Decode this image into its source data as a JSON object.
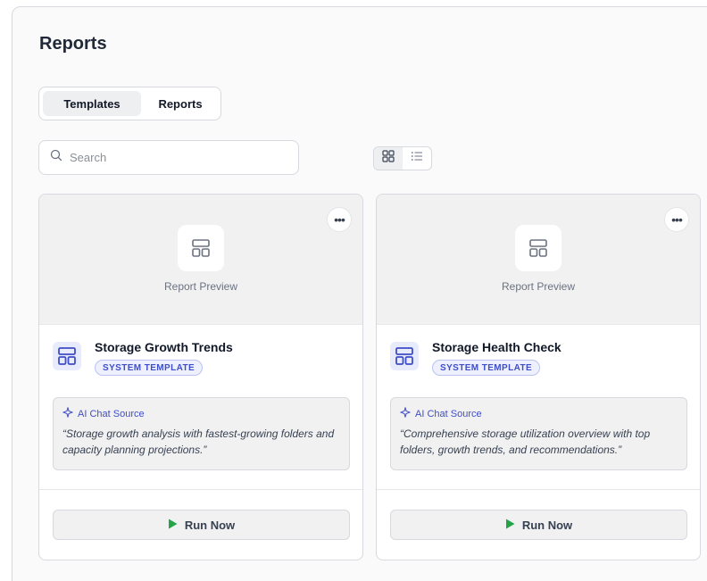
{
  "page": {
    "title": "Reports"
  },
  "tabs": [
    {
      "label": "Templates",
      "active": true
    },
    {
      "label": "Reports",
      "active": false
    }
  ],
  "search": {
    "placeholder": "Search",
    "value": ""
  },
  "view_toggle": {
    "selected": "grid",
    "options": [
      "grid-view-icon",
      "list-view-icon"
    ]
  },
  "colors": {
    "accent": "#3f4ec6",
    "run_icon": "#22a447",
    "badge_bg": "#eef1fd"
  },
  "cards": [
    {
      "preview_label": "Report Preview",
      "title": "Storage Growth Trends",
      "badge": "SYSTEM TEMPLATE",
      "source_label": "AI Chat Source",
      "source_quote": "“Storage growth analysis with fastest-growing folders and capacity planning projections.”",
      "run_label": "Run Now"
    },
    {
      "preview_label": "Report Preview",
      "title": "Storage Health Check",
      "badge": "SYSTEM TEMPLATE",
      "source_label": "AI Chat Source",
      "source_quote": "“Comprehensive storage utilization overview with top folders, growth trends, and recommendations.”",
      "run_label": "Run Now"
    }
  ]
}
